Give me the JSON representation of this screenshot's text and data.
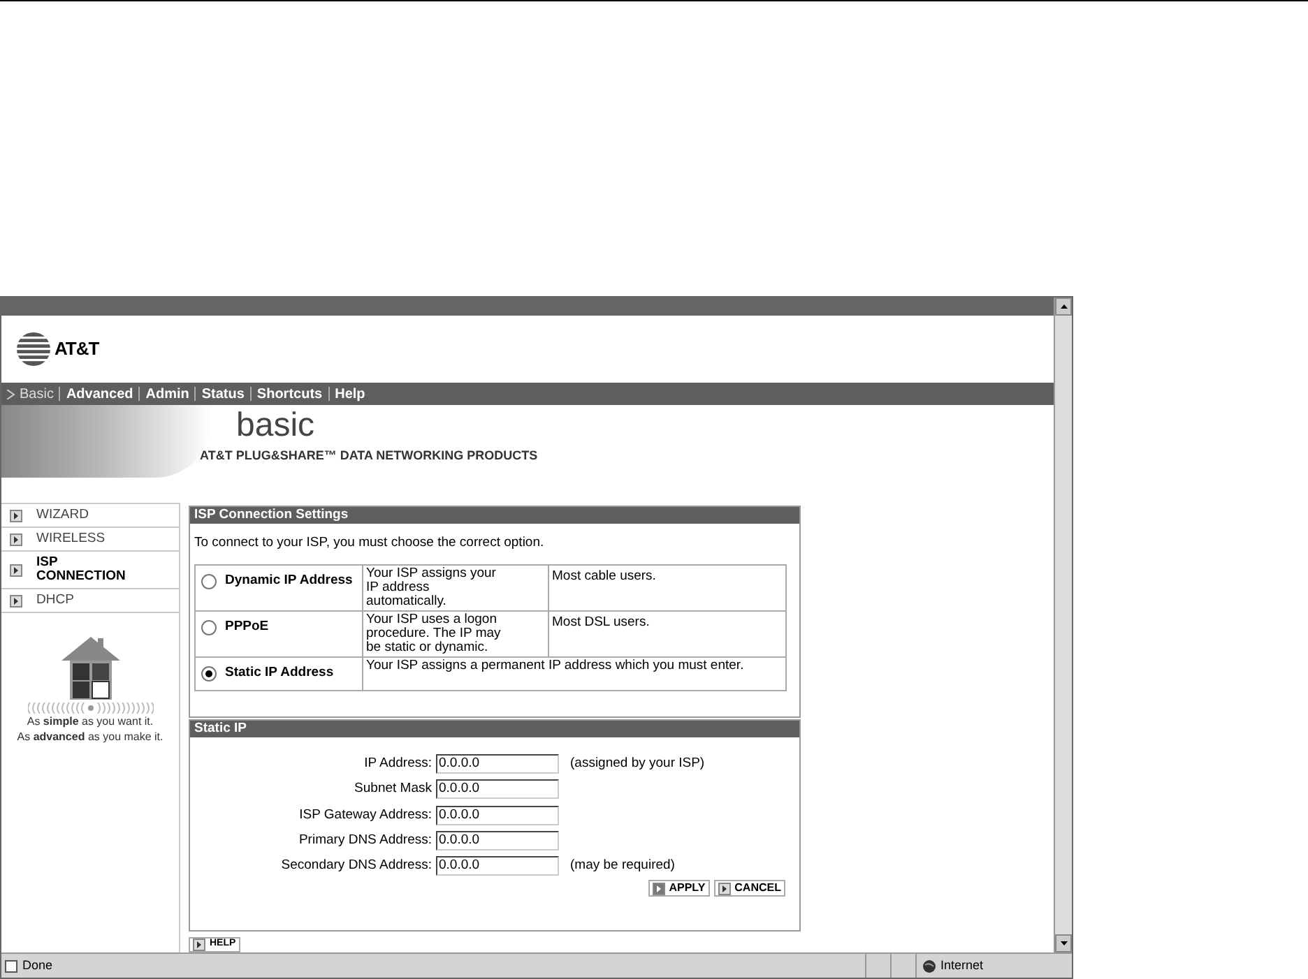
{
  "brand": {
    "logo_text": "AT&T"
  },
  "nav": [
    {
      "label": "Basic",
      "selected": true
    },
    {
      "label": "Advanced",
      "selected": false
    },
    {
      "label": "Admin",
      "selected": false
    },
    {
      "label": "Status",
      "selected": false
    },
    {
      "label": "Shortcuts",
      "selected": false
    },
    {
      "label": "Help",
      "selected": false
    }
  ],
  "banner": {
    "title": "basic",
    "subtitle": "AT&T PLUG&SHARE™ DATA NETWORKING PRODUCTS"
  },
  "sidebar": {
    "items": [
      {
        "label": "WIZARD",
        "selected": false
      },
      {
        "label": "WIRELESS",
        "selected": false
      },
      {
        "label": "ISP CONNECTION",
        "selected": true
      },
      {
        "label": "DHCP",
        "selected": false
      }
    ],
    "tagline": [
      "As **simple** as you want it.",
      "As **advanced** as you make it."
    ]
  },
  "isp_settings": {
    "title": "ISP Connection Settings",
    "intro": "To connect to your ISP, you must choose the correct option.",
    "options": [
      {
        "label": "Dynamic IP Address",
        "selected": false,
        "description": "Your ISP assigns your IP address automatically.",
        "note": "Most cable users."
      },
      {
        "label": "PPPoE",
        "selected": false,
        "description": "Your ISP uses a logon procedure. The IP may be static or dynamic.",
        "note": "Most DSL users."
      },
      {
        "label": "Static IP Address",
        "selected": true,
        "description": "Your ISP assigns a permanent IP address which you must enter."
      }
    ]
  },
  "static_ip": {
    "title": "Static IP",
    "fields": [
      {
        "label": "IP Address:",
        "value": "0.0.0.0",
        "hint": "(assigned by your ISP)"
      },
      {
        "label": "Subnet Mask",
        "value": "0.0.0.0"
      },
      {
        "label": "ISP Gateway Address:",
        "value": "0.0.0.0"
      },
      {
        "label": "Primary DNS Address:",
        "value": "0.0.0.0"
      },
      {
        "label": "Secondary DNS Address:",
        "value": "0.0.0.0",
        "hint": "(may be required)"
      }
    ],
    "buttons": [
      "APPLY",
      "CANCEL"
    ]
  },
  "help_button": "HELP",
  "status_bar": {
    "status": "Done",
    "zone": "Internet"
  }
}
